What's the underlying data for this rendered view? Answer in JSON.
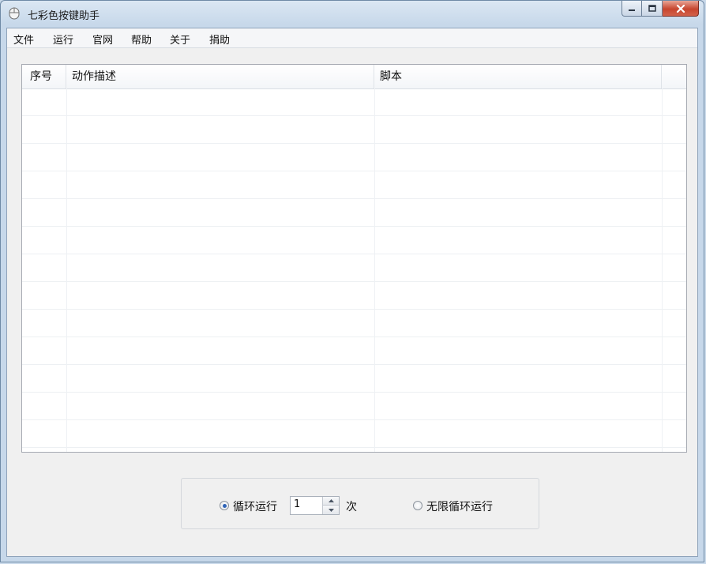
{
  "window": {
    "title": "七彩色按键助手"
  },
  "menu": [
    "文件",
    "运行",
    "官网",
    "帮助",
    "关于",
    "捐助"
  ],
  "table": {
    "columns": [
      "序号",
      "动作描述",
      "脚本"
    ],
    "rows": []
  },
  "loop": {
    "option_count_label": "循环运行",
    "count_value": "1",
    "count_unit": "次",
    "option_infinite_label": "无限循环运行",
    "selected": "循环运行"
  }
}
